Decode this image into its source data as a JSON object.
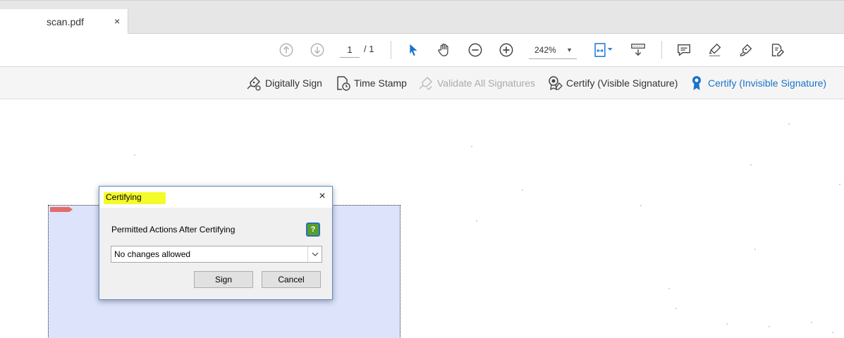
{
  "tab": {
    "title": "scan.pdf",
    "close": "×"
  },
  "toolbar": {
    "page_current": "1",
    "page_total": "/ 1",
    "zoom": "242%",
    "icons": [
      "page-up-icon",
      "page-down-icon",
      "select-cursor-icon",
      "hand-icon",
      "zoom-out-icon",
      "zoom-in-icon",
      "fit-page-icon",
      "scroll-mode-icon",
      "comment-icon",
      "highlight-icon",
      "sign-pen-icon",
      "edit-pdf-icon"
    ]
  },
  "sigbar": {
    "digitally_sign": "Digitally Sign",
    "time_stamp": "Time Stamp",
    "validate_all": "Validate All Signatures",
    "certify_visible": "Certify (Visible Signature)",
    "certify_invisible": "Certify (Invisible Signature)"
  },
  "dialog": {
    "title": "Certifying",
    "close": "×",
    "label": "Permitted Actions After Certifying",
    "help": "?",
    "select_value": "No changes allowed",
    "sign_label": "Sign",
    "cancel_label": "Cancel"
  },
  "colors": {
    "accent": "#1a73c8",
    "title_highlight": "#f4fb2a",
    "field_fill": "#dde3fb"
  }
}
